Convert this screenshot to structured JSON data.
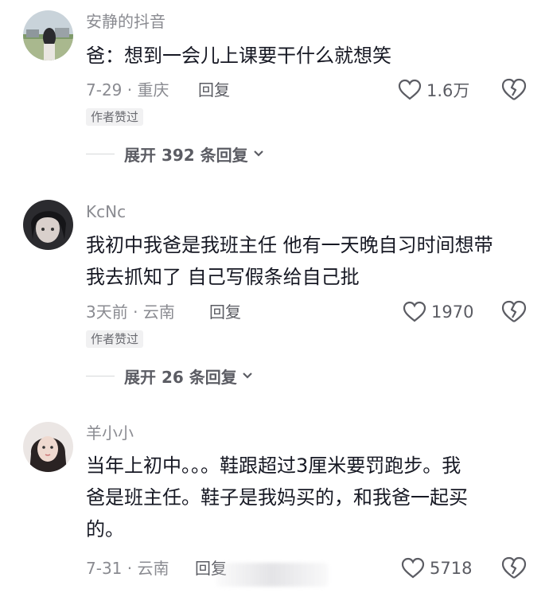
{
  "comments": [
    {
      "username": "安静的抖音",
      "lines": [
        "爸：想到一会儿上课要干什么就想笑"
      ],
      "meta": "7-29 · 重庆",
      "reply": "回复",
      "likes": "1.6万",
      "badge": "作者赞过",
      "expand": "展开 392 条回复"
    },
    {
      "username": "KcNc",
      "lines": [
        "我初中我爸是我班主任 他有一天晚自习时间想带",
        "我去抓知了 自己写假条给自己批"
      ],
      "meta": "3天前 · 云南",
      "reply": "回复",
      "likes": "1970",
      "badge": "作者赞过",
      "expand": "展开 26 条回复"
    },
    {
      "username": "羊小小",
      "lines": [
        "当年上初中。。。鞋跟超过3厘米要罚跑步。我",
        "爸是班主任。鞋子是我妈买的，和我爸一起买",
        "的。"
      ],
      "meta": "7-31 · 云南",
      "reply": "回复",
      "likes": "5718"
    }
  ],
  "icons": {
    "like": "heart-outline-icon",
    "dislike": "broken-heart-icon",
    "expand": "chevron-down-icon"
  },
  "colors": {
    "text": "#161823",
    "secondary": "#8a8b91",
    "badge_bg": "#f1f1f2"
  }
}
